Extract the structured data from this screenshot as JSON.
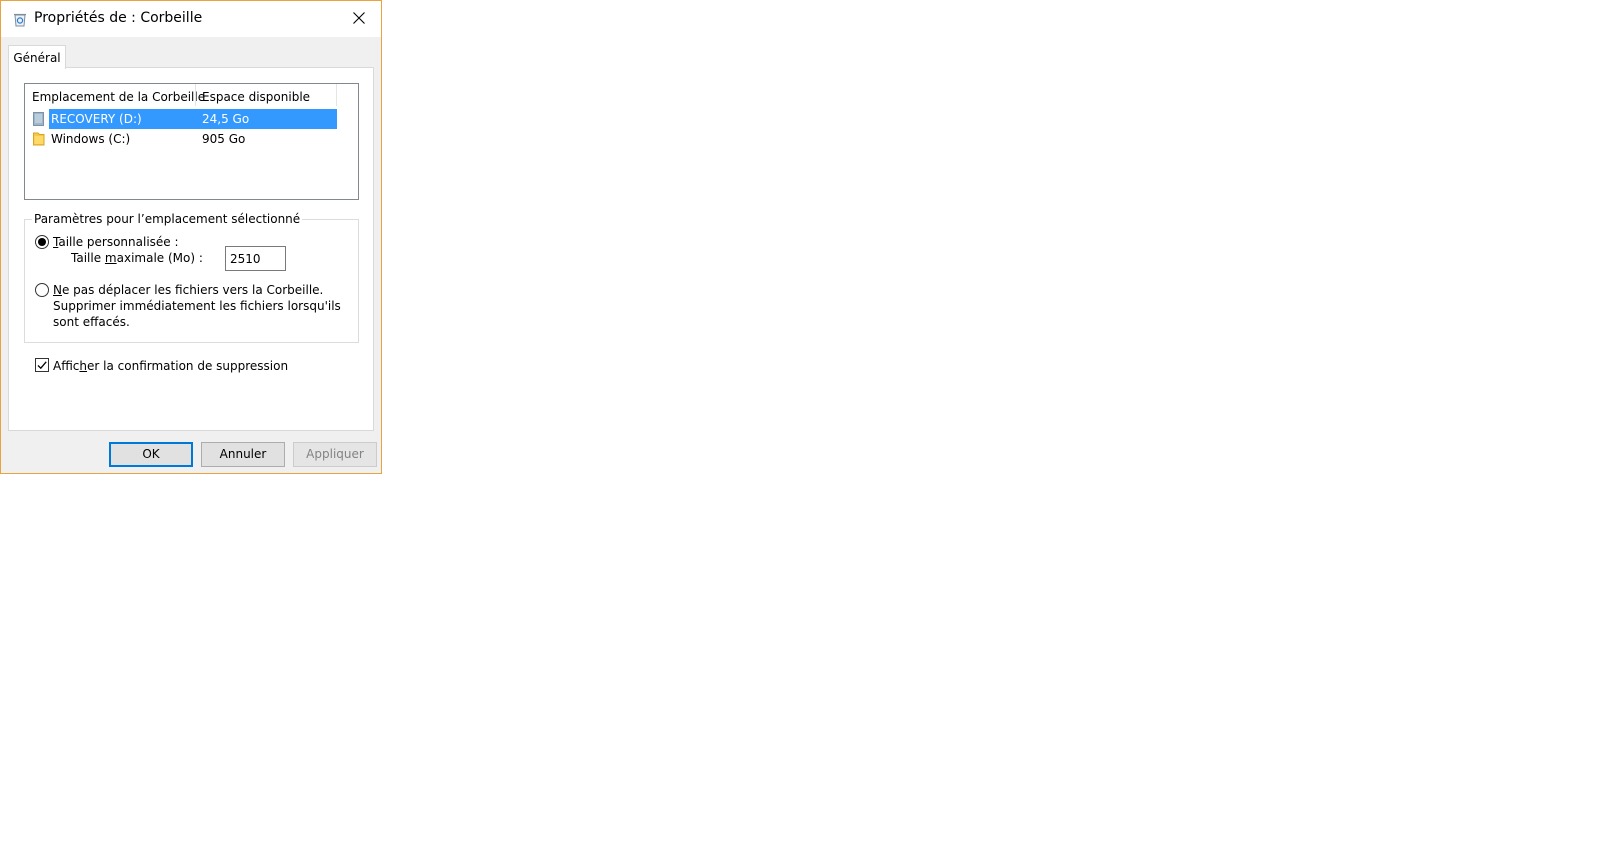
{
  "window": {
    "title": "Propriétés de : Corbeille",
    "title_icon": "recycle-bin-icon",
    "close_icon": "close-icon",
    "accent_border": "#e8a53f"
  },
  "tabs": [
    {
      "label": "Général",
      "active": true
    }
  ],
  "locations": {
    "headers": [
      "Emplacement de la Corbeille",
      "Espace disponible"
    ],
    "rows": [
      {
        "name": "RECOVERY (D:)",
        "space": "24,5 Go",
        "icon": "drive-icon",
        "selected": true
      },
      {
        "name": "Windows (C:)",
        "space": "905 Go",
        "icon": "folder-icon",
        "selected": false
      }
    ],
    "selection_color": "#3399ff"
  },
  "settings": {
    "legend": "Paramètres pour l’emplacement sélectionné",
    "custom_size": {
      "label_underlined": "T",
      "label_rest": "aille personnalisée :",
      "checked": true
    },
    "max_size": {
      "label_pre": "Taille ",
      "label_underlined": "m",
      "label_post": "aximale (Mo) :",
      "value": "2510"
    },
    "no_move": {
      "label_underlined": "N",
      "label_rest": "e pas déplacer les fichiers vers la Corbeille. Supprimer immédiatement les fichiers lorsqu'ils sont effacés.",
      "checked": false
    }
  },
  "confirm": {
    "label_pre": "Affic",
    "label_underlined": "h",
    "label_post": "er la confirmation de suppression",
    "checked": true
  },
  "buttons": {
    "ok": "OK",
    "cancel": "Annuler",
    "apply": "Appliquer",
    "apply_enabled": false
  }
}
